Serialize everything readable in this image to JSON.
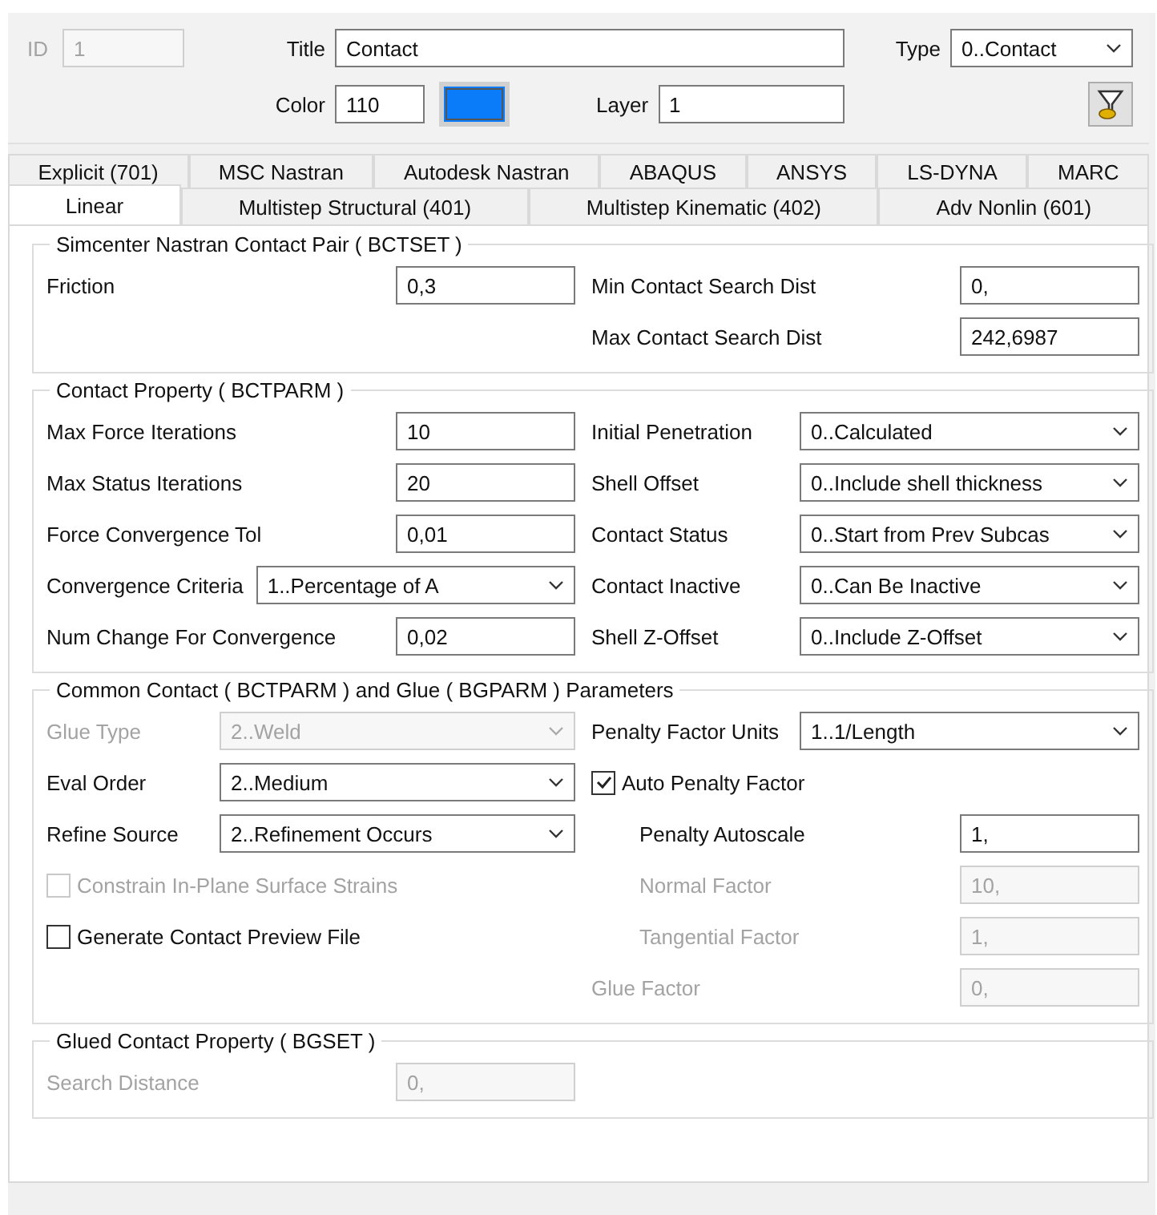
{
  "header": {
    "id": {
      "label": "ID",
      "value": "1",
      "disabled": true
    },
    "title": {
      "label": "Title",
      "value": "Contact"
    },
    "type": {
      "label": "Type",
      "value": "0..Contact"
    },
    "color": {
      "label": "Color",
      "value": "110",
      "color": "#0a7cfa"
    },
    "layer": {
      "label": "Layer",
      "value": "1"
    }
  },
  "tab_rows": [
    [
      {
        "label": "Explicit (701)",
        "selected": false
      },
      {
        "label": "MSC Nastran",
        "selected": false
      },
      {
        "label": "Autodesk Nastran",
        "selected": false
      },
      {
        "label": "ABAQUS",
        "selected": false
      },
      {
        "label": "ANSYS",
        "selected": false
      },
      {
        "label": "LS-DYNA",
        "selected": false
      },
      {
        "label": "MARC",
        "selected": false
      }
    ],
    [
      {
        "label": "Linear",
        "selected": true
      },
      {
        "label": "Multistep Structural (401)",
        "selected": false
      },
      {
        "label": "Multistep Kinematic (402)",
        "selected": false
      },
      {
        "label": "Adv Nonlin (601)",
        "selected": false
      }
    ]
  ],
  "groups": [
    {
      "title": "Simcenter Nastran Contact Pair ( BCTSET )",
      "left": [
        {
          "kind": "text",
          "label": "Friction",
          "value": "0,3",
          "disabled": false
        }
      ],
      "right": [
        {
          "kind": "text",
          "label": "Min Contact Search Dist",
          "value": "0,",
          "disabled": false
        },
        {
          "kind": "text",
          "label": "Max Contact Search Dist",
          "value": "242,6987",
          "disabled": false
        }
      ]
    },
    {
      "title": "Contact Property ( BCTPARM )",
      "left": [
        {
          "kind": "text",
          "label": "Max Force Iterations",
          "value": "10",
          "disabled": false
        },
        {
          "kind": "text",
          "label": "Max Status Iterations",
          "value": "20",
          "disabled": false
        },
        {
          "kind": "text",
          "label": "Force Convergence Tol",
          "value": "0,01",
          "disabled": false
        },
        {
          "kind": "select",
          "label": "Convergence Criteria",
          "value": "1..Percentage of A",
          "disabled": false
        },
        {
          "kind": "text",
          "label": "Num Change For Convergence",
          "value": "0,02",
          "disabled": false
        }
      ],
      "right": [
        {
          "kind": "select",
          "label": "Initial Penetration",
          "value": "0..Calculated",
          "disabled": false
        },
        {
          "kind": "select",
          "label": "Shell Offset",
          "value": "0..Include shell thickness",
          "disabled": false
        },
        {
          "kind": "select",
          "label": "Contact Status",
          "value": "0..Start from Prev Subcas",
          "disabled": false
        },
        {
          "kind": "select",
          "label": "Contact Inactive",
          "value": "0..Can Be Inactive",
          "disabled": false
        },
        {
          "kind": "select",
          "label": "Shell Z-Offset",
          "value": "0..Include Z-Offset",
          "disabled": false
        }
      ]
    },
    {
      "title": "Common Contact ( BCTPARM ) and Glue ( BGPARM ) Parameters",
      "left": [
        {
          "kind": "select",
          "label": "Glue Type",
          "value": "2..Weld",
          "disabled": true
        },
        {
          "kind": "select",
          "label": "Eval Order",
          "value": "2..Medium",
          "disabled": false
        },
        {
          "kind": "select",
          "label": "Refine Source",
          "value": "2..Refinement Occurs",
          "disabled": false
        },
        {
          "kind": "check",
          "label": "Constrain In-Plane Surface Strains",
          "checked": false,
          "disabled": true
        },
        {
          "kind": "check",
          "label": "Generate Contact Preview File",
          "checked": false,
          "disabled": false
        }
      ],
      "right": [
        {
          "kind": "select",
          "label": "Penalty Factor Units",
          "value": "1..1/Length",
          "disabled": false
        },
        {
          "kind": "check",
          "label": "Auto Penalty Factor",
          "checked": true,
          "disabled": false,
          "children": [
            {
              "kind": "text",
              "label": "Penalty Autoscale",
              "value": "1,",
              "disabled": false
            },
            {
              "kind": "text",
              "label": "Normal Factor",
              "value": "10,",
              "disabled": true
            },
            {
              "kind": "text",
              "label": "Tangential Factor",
              "value": "1,",
              "disabled": true
            }
          ]
        },
        {
          "kind": "text",
          "label": "Glue Factor",
          "value": "0,",
          "disabled": true
        }
      ]
    },
    {
      "title": "Glued Contact Property ( BGSET )",
      "left": [
        {
          "kind": "text",
          "label": "Search Distance",
          "value": "0,",
          "disabled": true
        }
      ]
    }
  ]
}
